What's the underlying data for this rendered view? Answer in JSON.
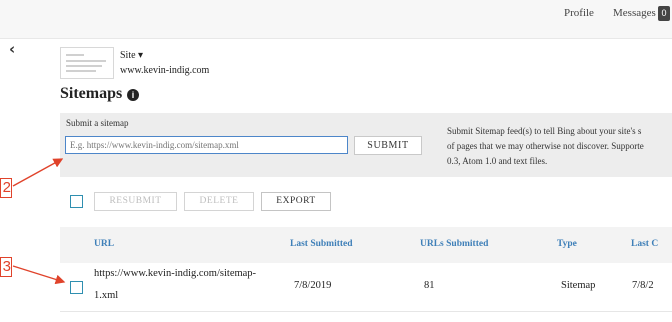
{
  "topnav": {
    "profile_label": "Profile",
    "messages_label": "Messages",
    "messages_count": "0"
  },
  "back_icon": "chevron-left-icon",
  "site": {
    "label": "Site ▾",
    "url": "www.kevin-indig.com"
  },
  "page": {
    "title": "Sitemaps",
    "info_icon": "i"
  },
  "submit_form": {
    "label": "Submit a sitemap",
    "input_value": "",
    "input_placeholder": "E.g. https://www.kevin-indig.com/sitemap.xml",
    "submit_label": "SUBMIT",
    "help_lines": [
      "Submit Sitemap feed(s) to tell Bing about your site's s",
      "of pages that we may otherwise not discover. Supporte",
      "0.3, Atom 1.0 and text files."
    ]
  },
  "actions": {
    "resubmit_label": "RESUBMIT",
    "delete_label": "DELETE",
    "export_label": "EXPORT"
  },
  "table": {
    "headers": [
      "URL",
      "Last Submitted",
      "URLs Submitted",
      "Type",
      "Last C"
    ],
    "rows": [
      {
        "url_line1": "https://www.kevin-indig.com/sitemap-",
        "url_line2": "1.xml",
        "last_submitted": "7/8/2019",
        "urls_submitted": "81",
        "type": "Sitemap",
        "last_crawled": "7/8/2"
      }
    ]
  },
  "annotations": {
    "callout_2": "2",
    "callout_3": "3",
    "color": "#e0432b"
  },
  "colors": {
    "accent_blue": "#3e7fb8",
    "checkbox_teal": "#2f8fb0",
    "input_border": "#4d86c9"
  }
}
